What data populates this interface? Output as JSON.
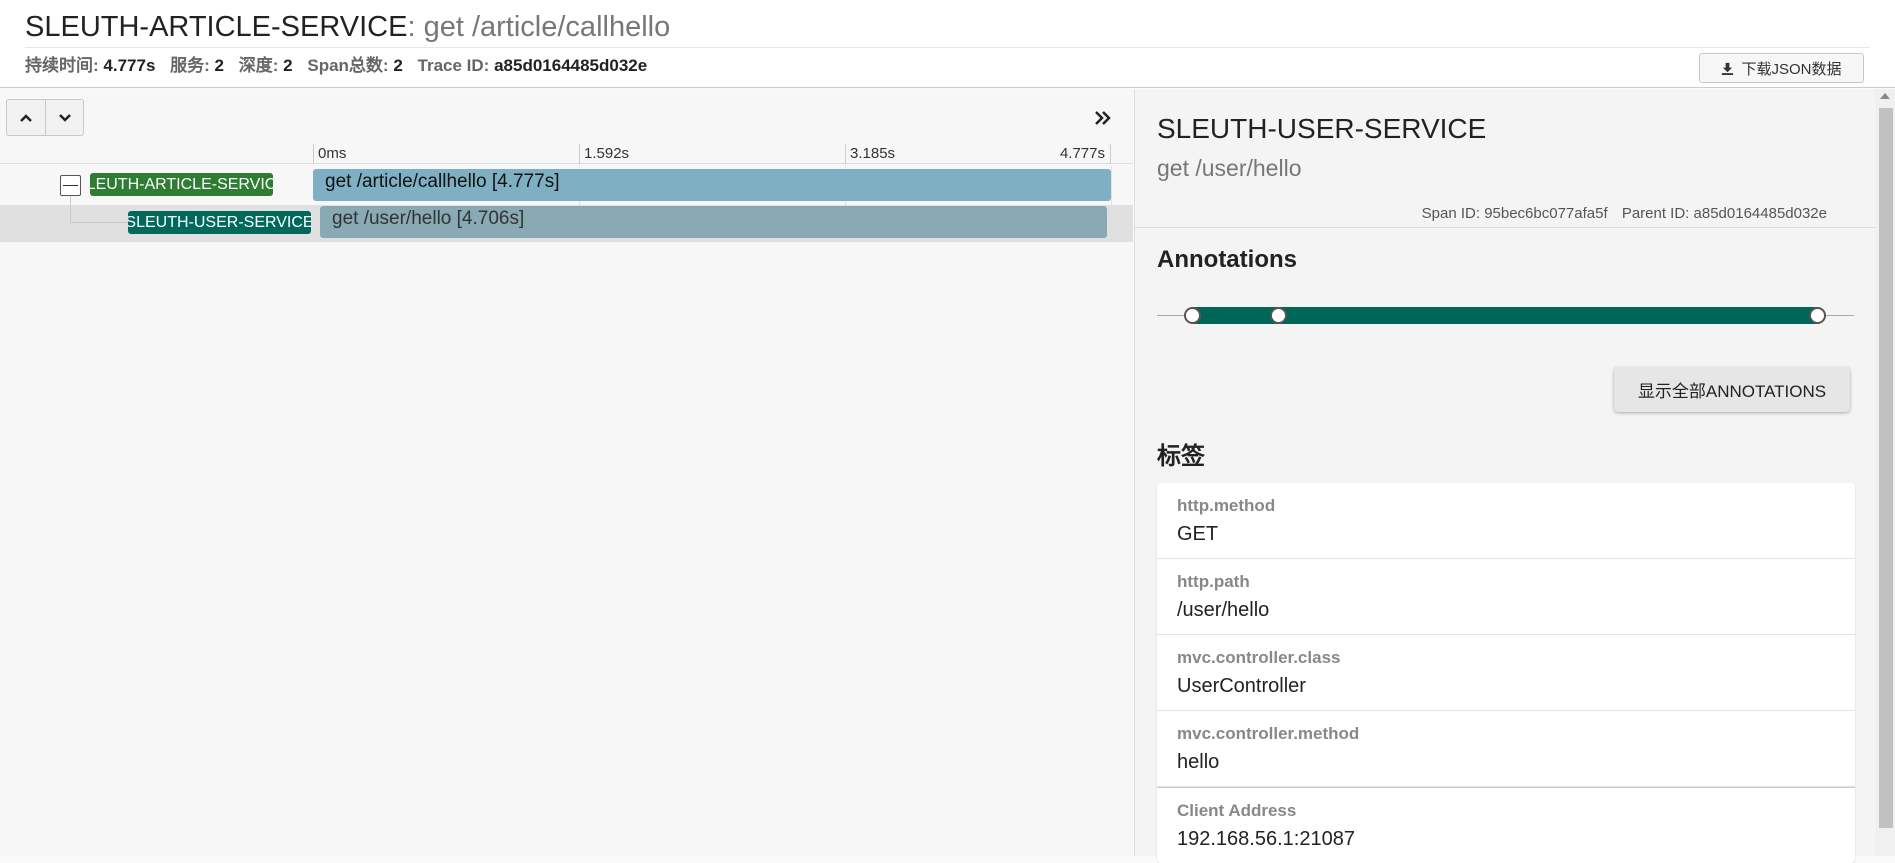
{
  "header": {
    "service": "SLEUTH-ARTICLE-SERVICE",
    "separator": ": ",
    "operation": "get /article/callhello",
    "meta": [
      {
        "label": "持续时间:",
        "value": "4.777s"
      },
      {
        "label": "服务:",
        "value": "2"
      },
      {
        "label": "深度:",
        "value": "2"
      },
      {
        "label": "Span总数:",
        "value": "2"
      },
      {
        "label": "Trace ID:",
        "value": "a85d0164485d032e"
      }
    ],
    "download_button": "下载JSON数据",
    "download_icon": "download-icon"
  },
  "timeline": {
    "ticks": [
      "0ms",
      "1.592s",
      "3.185s",
      "4.777s"
    ],
    "spans": [
      {
        "service": "SLEUTH-ARTICLE-SERVICE",
        "label": "get /article/callhello [4.777s]",
        "color": "#2e7d32"
      },
      {
        "service": "SLEUTH-USER-SERVICE",
        "label": "get /user/hello [4.706s]",
        "color": "#00695c"
      }
    ]
  },
  "detail": {
    "service": "SLEUTH-USER-SERVICE",
    "operation": "get /user/hello",
    "span_id_label": "Span ID:",
    "span_id": "95bec6bc077afa5f",
    "parent_id_label": "Parent ID:",
    "parent_id": "a85d0164485d032e",
    "annotations_title": "Annotations",
    "show_all_button": "显示全部ANNOTATIONS",
    "tags_title": "标签",
    "tags": [
      {
        "key": "http.method",
        "value": "GET"
      },
      {
        "key": "http.path",
        "value": "/user/hello"
      },
      {
        "key": "mvc.controller.class",
        "value": "UserController"
      },
      {
        "key": "mvc.controller.method",
        "value": "hello"
      },
      {
        "key": "Client Address",
        "value": "192.168.56.1:21087"
      }
    ],
    "accent_color": "#006658"
  }
}
